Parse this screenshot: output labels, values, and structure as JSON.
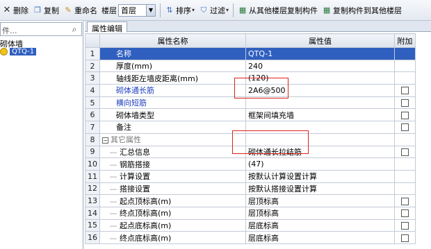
{
  "toolbar": {
    "delete_label": "删除",
    "copy_label": "复制",
    "rename_label": "重命名",
    "floor_label": "楼层",
    "floor_value": "首层",
    "sort_label": "排序",
    "filter_label": "过滤",
    "copy_from_other_label": "从其他楼层复制构件",
    "copy_to_other_label": "复制构件到其他楼层"
  },
  "left": {
    "search_text": "件...",
    "tree_parent": "砌体墙",
    "tree_selected": "QTQ-1"
  },
  "tab_label": "属性编辑",
  "grid": {
    "headers": [
      "属性名称",
      "属性值",
      "附加"
    ],
    "rows": [
      {
        "num": "1",
        "name": "名称",
        "value": "QTQ-1"
      },
      {
        "num": "2",
        "name": "厚度(mm)",
        "value": "240"
      },
      {
        "num": "3",
        "name": "轴线距左墙皮距离(mm)",
        "value": "(120)"
      },
      {
        "num": "4",
        "name": "砌体通长筋",
        "value": "2A6@500"
      },
      {
        "num": "5",
        "name": "横向短筋",
        "value": ""
      },
      {
        "num": "6",
        "name": "砌体墙类型",
        "value": "框架间填充墙"
      },
      {
        "num": "7",
        "name": "备注",
        "value": ""
      },
      {
        "num": "8",
        "name": "其它属性",
        "value": ""
      },
      {
        "num": "9",
        "name": "汇总信息",
        "value": "砌体通长拉结筋"
      },
      {
        "num": "10",
        "name": "钢筋搭接",
        "value": "(47)"
      },
      {
        "num": "11",
        "name": "计算设置",
        "value": "按默认计算设置计算"
      },
      {
        "num": "12",
        "name": "搭接设置",
        "value": "按默认搭接设置计算"
      },
      {
        "num": "13",
        "name": "起点顶标高(m)",
        "value": "层顶标高"
      },
      {
        "num": "14",
        "name": "终点顶标高(m)",
        "value": "层顶标高"
      },
      {
        "num": "15",
        "name": "起点底标高(m)",
        "value": "层底标高"
      },
      {
        "num": "16",
        "name": "终点底标高(m)",
        "value": "层底标高"
      }
    ]
  }
}
